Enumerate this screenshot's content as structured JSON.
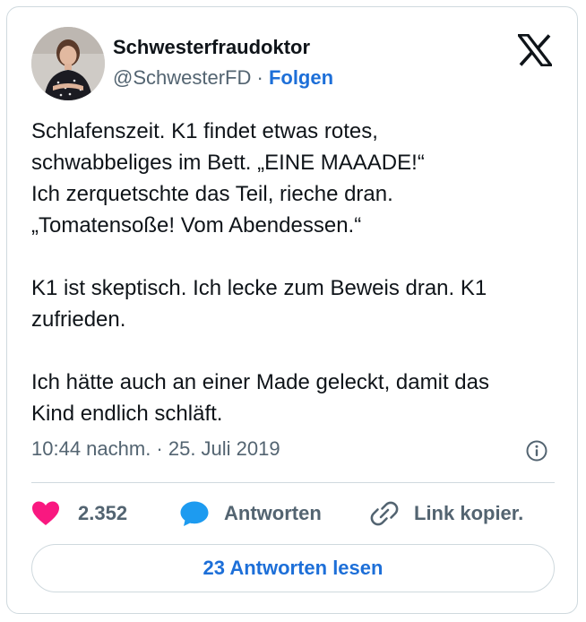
{
  "author": {
    "name": "Schwesterfraudoktor",
    "handle": "@SchwesterFD",
    "separator": " · ",
    "follow_label": "Folgen"
  },
  "tweet": {
    "paragraphs": [
      [
        "Schlafenszeit. K1 findet etwas rotes,",
        "schwabbeliges im Bett. „EINE MAAADE!“",
        "Ich zerquetschte das Teil, rieche dran.",
        "„Tomatensoße! Vom Abendessen.“"
      ],
      [
        "K1 ist skeptisch. Ich lecke zum Beweis dran. K1",
        "zufrieden."
      ],
      [
        "Ich hätte auch an einer Made geleckt, damit das",
        "Kind endlich schläft."
      ]
    ],
    "timestamp": "10:44 nachm. · 25. Juli 2019"
  },
  "actions": {
    "like_count": "2.352",
    "reply_label": "Antworten",
    "copy_link_label": "Link kopier."
  },
  "read_replies_label": "23 Antworten lesen",
  "colors": {
    "like": "#f91880",
    "reply": "#1d9bf0",
    "link_blue": "#1d6fd8",
    "muted": "#536471",
    "border": "#cfd9de"
  },
  "icons": [
    "x-logo-icon",
    "info-icon",
    "heart-icon",
    "speech-bubble-icon",
    "link-icon"
  ]
}
